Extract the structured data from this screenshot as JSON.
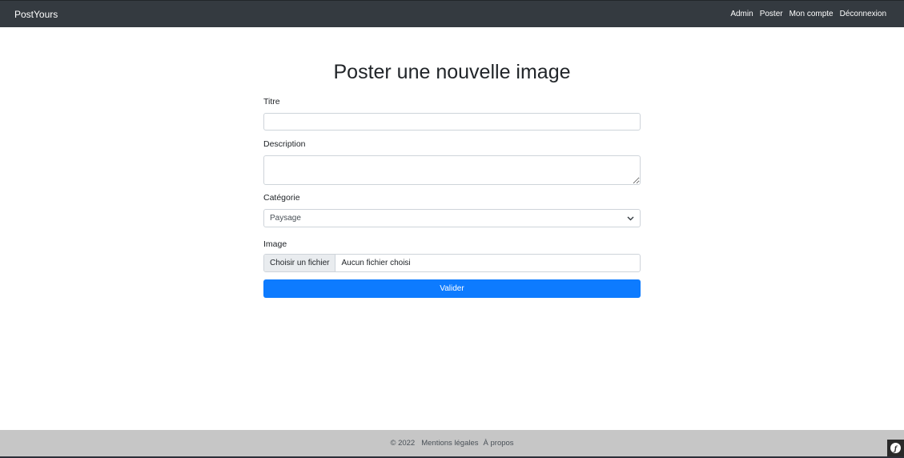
{
  "navbar": {
    "brand": "PostYours",
    "links": [
      "Admin",
      "Poster",
      "Mon compte",
      "Déconnexion"
    ]
  },
  "page": {
    "title": "Poster une nouvelle image"
  },
  "form": {
    "title_label": "Titre",
    "title_value": "",
    "description_label": "Description",
    "description_value": "",
    "category_label": "Catégorie",
    "category_selected": "Paysage",
    "image_label": "Image",
    "file_button": "Choisir un fichier",
    "file_status": "Aucun fichier choisi",
    "submit_label": "Valider"
  },
  "footer": {
    "copyright": "© 2022",
    "legal": "Mentions légales",
    "about": "À propos"
  },
  "icons": {
    "select_chevron": "chevron-down-icon",
    "symfony_badge": "symfony-toolbar-icon"
  },
  "colors": {
    "navbar_bg": "#343a40",
    "primary": "#0d7bff",
    "footer_bg": "#c6c6c6"
  }
}
